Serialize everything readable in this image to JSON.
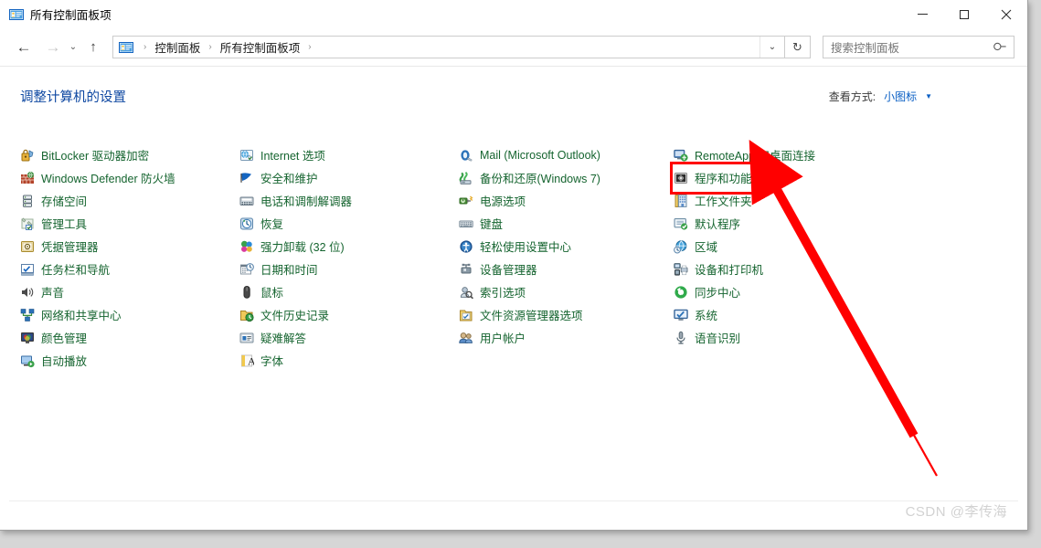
{
  "window": {
    "title": "所有控制面板项",
    "title_icon": "control-panel-icon",
    "minimize": "—",
    "maximize": "□",
    "close": "✕"
  },
  "nav": {
    "back_icon": "←",
    "forward_icon": "→",
    "recent_icon": "⌄",
    "up_icon": "↑",
    "breadcrumbs": [
      "控制面板",
      "所有控制面板项"
    ],
    "separator": "›",
    "dropdown_icon": "⌄",
    "refresh_icon": "↻"
  },
  "search": {
    "placeholder": "搜索控制面板",
    "icon": "search-icon"
  },
  "content": {
    "heading": "调整计算机的设置",
    "view_by_label": "查看方式:",
    "view_by_value": "小图标",
    "view_by_caret": "▼"
  },
  "columns": [
    {
      "items": [
        {
          "label": "BitLocker 驱动器加密",
          "icon": "bitlocker-icon"
        },
        {
          "label": "Windows Defender 防火墙",
          "icon": "firewall-icon"
        },
        {
          "label": "存储空间",
          "icon": "storage-spaces-icon"
        },
        {
          "label": "管理工具",
          "icon": "admin-tools-icon"
        },
        {
          "label": "凭据管理器",
          "icon": "credential-manager-icon"
        },
        {
          "label": "任务栏和导航",
          "icon": "taskbar-navigation-icon"
        },
        {
          "label": "声音",
          "icon": "sound-icon"
        },
        {
          "label": "网络和共享中心",
          "icon": "network-sharing-icon"
        },
        {
          "label": "颜色管理",
          "icon": "color-management-icon"
        },
        {
          "label": "自动播放",
          "icon": "autoplay-icon"
        }
      ]
    },
    {
      "items": [
        {
          "label": "Internet 选项",
          "icon": "internet-options-icon"
        },
        {
          "label": "安全和维护",
          "icon": "security-maintenance-icon"
        },
        {
          "label": "电话和调制解调器",
          "icon": "phone-modem-icon"
        },
        {
          "label": "恢复",
          "icon": "recovery-icon"
        },
        {
          "label": "强力卸载 (32 位)",
          "icon": "force-uninstall-icon"
        },
        {
          "label": "日期和时间",
          "icon": "date-time-icon"
        },
        {
          "label": "鼠标",
          "icon": "mouse-icon"
        },
        {
          "label": "文件历史记录",
          "icon": "file-history-icon"
        },
        {
          "label": "疑难解答",
          "icon": "troubleshooting-icon"
        },
        {
          "label": "字体",
          "icon": "fonts-icon"
        }
      ]
    },
    {
      "items": [
        {
          "label": "Mail (Microsoft Outlook)",
          "icon": "mail-icon"
        },
        {
          "label": "备份和还原(Windows 7)",
          "icon": "backup-restore-icon"
        },
        {
          "label": "电源选项",
          "icon": "power-options-icon"
        },
        {
          "label": "键盘",
          "icon": "keyboard-icon"
        },
        {
          "label": "轻松使用设置中心",
          "icon": "ease-of-access-icon"
        },
        {
          "label": "设备管理器",
          "icon": "device-manager-icon"
        },
        {
          "label": "索引选项",
          "icon": "indexing-options-icon"
        },
        {
          "label": "文件资源管理器选项",
          "icon": "file-explorer-options-icon"
        },
        {
          "label": "用户帐户",
          "icon": "user-accounts-icon"
        }
      ]
    },
    {
      "items": [
        {
          "label": "RemoteApp 和桌面连接",
          "icon": "remoteapp-icon"
        },
        {
          "label": "程序和功能",
          "icon": "programs-features-icon"
        },
        {
          "label": "工作文件夹",
          "icon": "work-folders-icon"
        },
        {
          "label": "默认程序",
          "icon": "default-programs-icon"
        },
        {
          "label": "区域",
          "icon": "region-icon"
        },
        {
          "label": "设备和打印机",
          "icon": "devices-printers-icon"
        },
        {
          "label": "同步中心",
          "icon": "sync-center-icon"
        },
        {
          "label": "系统",
          "icon": "system-icon"
        },
        {
          "label": "语音识别",
          "icon": "speech-recognition-icon"
        }
      ]
    }
  ],
  "annotation": {
    "highlight_target": "程序和功能",
    "highlight_color": "#ff0000",
    "arrow_color": "#ff0000"
  },
  "watermark": {
    "text": "CSDN @李传海"
  }
}
